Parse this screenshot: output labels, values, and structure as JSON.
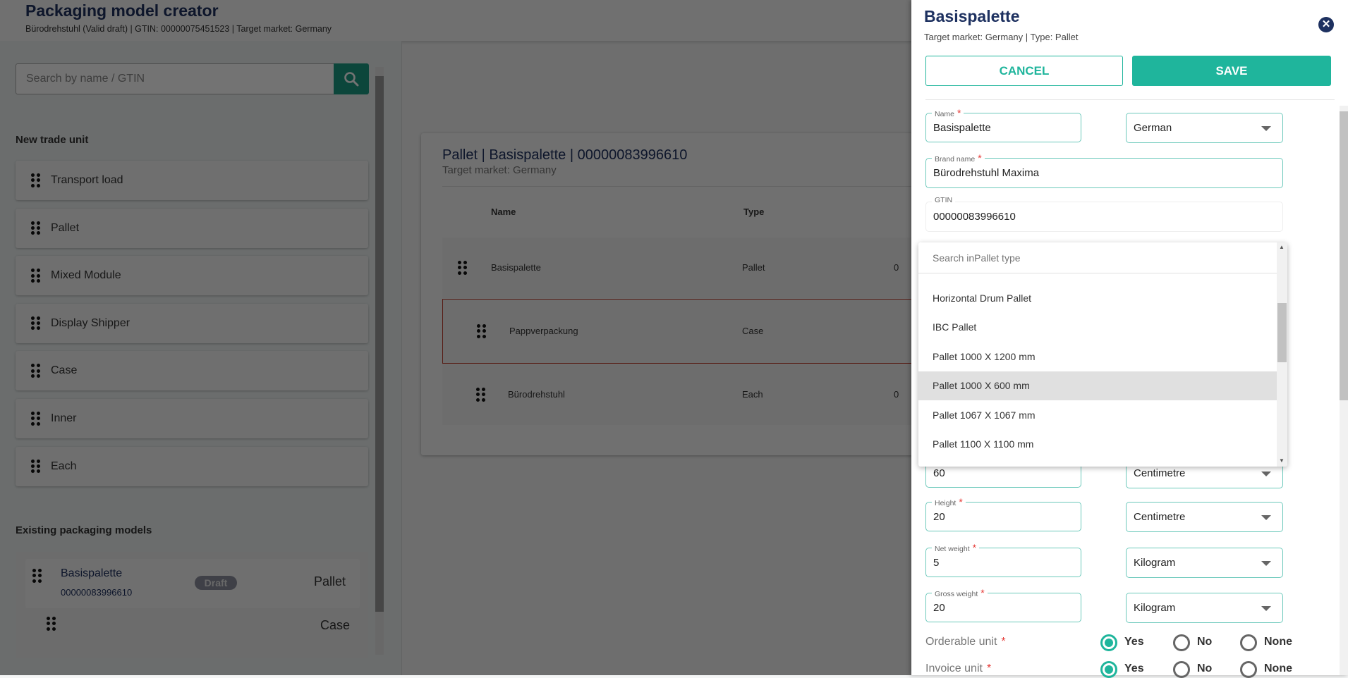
{
  "header": {
    "title": "Packaging model creator",
    "subtitle": "Bürodrehstuhl (Valid draft) | GTIN: 00000075451523 | Target market: Germany"
  },
  "left": {
    "search_placeholder": "Search by name / GTIN",
    "new_trade_unit_title": "New trade unit",
    "trade_units": [
      "Transport load",
      "Pallet",
      "Mixed Module",
      "Display Shipper",
      "Case",
      "Inner",
      "Each"
    ],
    "existing_title": "Existing packaging models",
    "existing": [
      {
        "name": "Basispalette",
        "gtin": "00000083996610",
        "badge": "Draft",
        "type": "Pallet"
      },
      {
        "name": "",
        "type": "Case"
      }
    ]
  },
  "card": {
    "title": "Pallet | Basispalette | 00000083996610",
    "subtitle": "Target market: Germany",
    "columns": [
      "Name",
      "Type"
    ],
    "rows": [
      {
        "name": "Basispalette",
        "type": "Pallet",
        "gtin": "0"
      },
      {
        "name": "Pappverpackung",
        "type": "Case",
        "gtin": ""
      },
      {
        "name": "Bürodrehstuhl",
        "type": "Each",
        "gtin": "0"
      }
    ]
  },
  "panel": {
    "title": "Basispalette",
    "subtitle": "Target market: Germany | Type: Pallet",
    "cancel": "CANCEL",
    "save": "SAVE",
    "name_label": "Name",
    "name_value": "Basispalette",
    "language": "German",
    "brand_label": "Brand name",
    "brand_value": "Bürodrehstuhl Maxima",
    "gtin_label": "GTIN",
    "gtin_value": "00000083996610",
    "dropdown": {
      "search_placeholder": "Search inPallet type",
      "options": [
        "Horizontal Drum Pallet",
        "IBC Pallet",
        "Pallet 1000 X 1200 mm",
        "Pallet 1000 X 600 mm",
        "Pallet 1067 X 1067 mm",
        "Pallet 1100 X 1100 mm"
      ],
      "highlighted": "Pallet 1000 X 600 mm"
    },
    "width_value": "60",
    "width_unit": "Centimetre",
    "height_label": "Height",
    "height_value": "20",
    "height_unit": "Centimetre",
    "net_label": "Net weight",
    "net_value": "5",
    "net_unit": "Kilogram",
    "gross_label": "Gross weight",
    "gross_value": "20",
    "gross_unit": "Kilogram",
    "orderable_label": "Orderable unit",
    "invoice_label": "Invoice unit",
    "radio_options": [
      "Yes",
      "No",
      "None"
    ],
    "orderable_selected": "Yes",
    "invoice_selected": "Yes"
  },
  "colors": {
    "accent": "#1fb59c",
    "title": "#1e3160",
    "required": "#e53935"
  }
}
